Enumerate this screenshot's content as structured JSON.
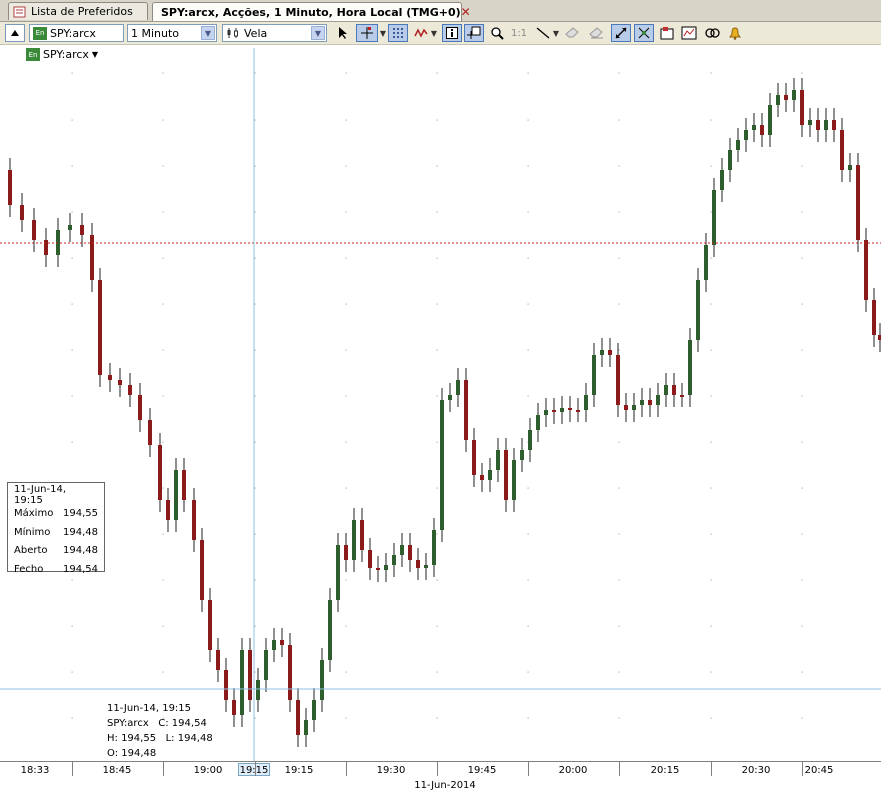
{
  "tabs": {
    "watchlist": "Lista de Preferidos",
    "chart": "SPY:arcx, Acções, 1 Minuto, Hora Local (TMG+0)",
    "close_glyph": "✕"
  },
  "toolbar": {
    "symbol": "SPY:arcx",
    "interval": "1 Minuto",
    "chart_type": "Vela",
    "ratio": "1:1"
  },
  "legend": {
    "symbol": "SPY:arcx"
  },
  "info_box": {
    "datetime": "11-Jun-14, 19:15",
    "rows": [
      {
        "label": "Máximo",
        "value": "194,55"
      },
      {
        "label": "Mínimo",
        "value": "194,48"
      },
      {
        "label": "Aberto",
        "value": "194,48"
      },
      {
        "label": "Fecho",
        "value": "194,54"
      }
    ]
  },
  "tooltip": {
    "datetime": "11-Jun-14, 19:15",
    "line2": "SPY:arcx   C: 194,54",
    "line3": "H: 194,55   L: 194,48",
    "line4": "O: 194,48"
  },
  "x_axis": {
    "ticks": [
      "18:33",
      "18:45",
      "19:00",
      "19:15",
      "19:15",
      "19:30",
      "19:45",
      "20:00",
      "20:15",
      "20:30",
      "20:45"
    ],
    "highlight": "19:15",
    "date": "11-Jun-2014"
  },
  "colors": {
    "up": "#2e5d2e",
    "down": "#8b1a1a",
    "crosshair": "#8fc3e6",
    "last_price": "#c82020"
  }
}
